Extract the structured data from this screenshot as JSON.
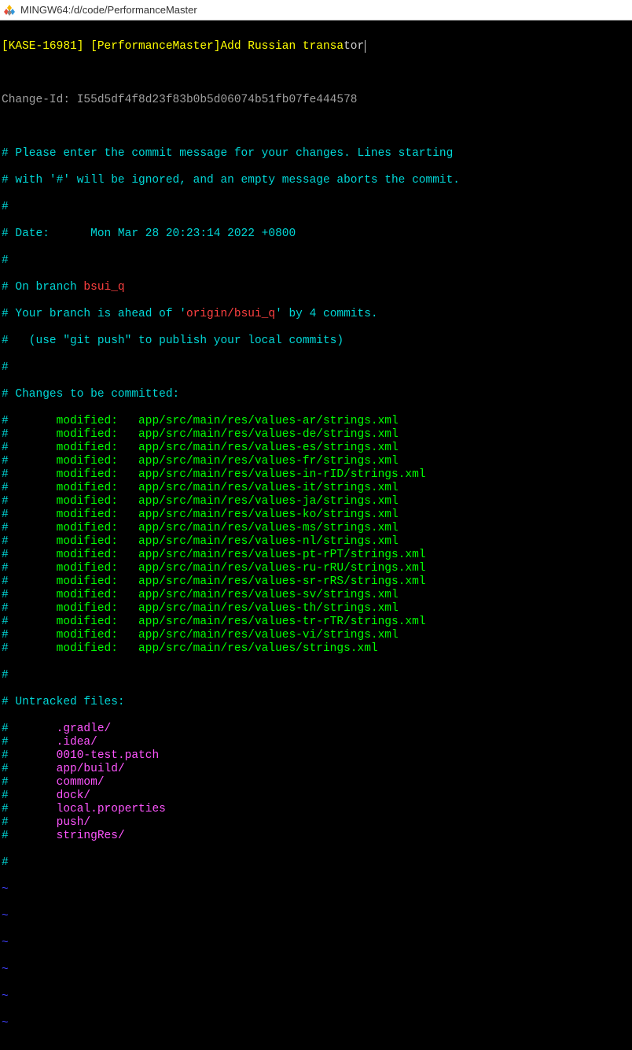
{
  "window": {
    "title": "MINGW64:/d/code/PerformanceMaster"
  },
  "commit": {
    "tag": "[KASE-16981] [PerformanceMaster]",
    "subject": "Add Russian transa",
    "subject_tail": "tor"
  },
  "change_id": {
    "label": "Change-Id: ",
    "value": "I55d5df4f8d23f83b0b5d06074b51fb07fe444578"
  },
  "instructions": {
    "l1": "# Please enter the commit message for your changes. Lines starting",
    "l2": "# with '#' will be ignored, and an empty message aborts the commit."
  },
  "date": {
    "label": "# Date:      ",
    "value": "Mon Mar 28 20:23:14 2022 +0800"
  },
  "branch": {
    "prefix": "# On branch ",
    "name": "bsui_q",
    "ahead_pre": "# Your branch is ahead of '",
    "remote": "origin/bsui_q",
    "ahead_post": "' by 4 commits.",
    "push_hint": "#   (use \"git push\" to publish your local commits)"
  },
  "changes_header": "# Changes to be committed:",
  "modified": [
    "app/src/main/res/values-ar/strings.xml",
    "app/src/main/res/values-de/strings.xml",
    "app/src/main/res/values-es/strings.xml",
    "app/src/main/res/values-fr/strings.xml",
    "app/src/main/res/values-in-rID/strings.xml",
    "app/src/main/res/values-it/strings.xml",
    "app/src/main/res/values-ja/strings.xml",
    "app/src/main/res/values-ko/strings.xml",
    "app/src/main/res/values-ms/strings.xml",
    "app/src/main/res/values-nl/strings.xml",
    "app/src/main/res/values-pt-rPT/strings.xml",
    "app/src/main/res/values-ru-rRU/strings.xml",
    "app/src/main/res/values-sr-rRS/strings.xml",
    "app/src/main/res/values-sv/strings.xml",
    "app/src/main/res/values-th/strings.xml",
    "app/src/main/res/values-tr-rTR/strings.xml",
    "app/src/main/res/values-vi/strings.xml",
    "app/src/main/res/values/strings.xml"
  ],
  "modified_label": "modified:   ",
  "untracked_header": "# Untracked files:",
  "untracked": [
    ".gradle/",
    ".idea/",
    "0010-test.patch",
    "app/build/",
    "commom/",
    "dock/",
    "local.properties",
    "push/",
    "stringRes/"
  ],
  "tilde": "~"
}
